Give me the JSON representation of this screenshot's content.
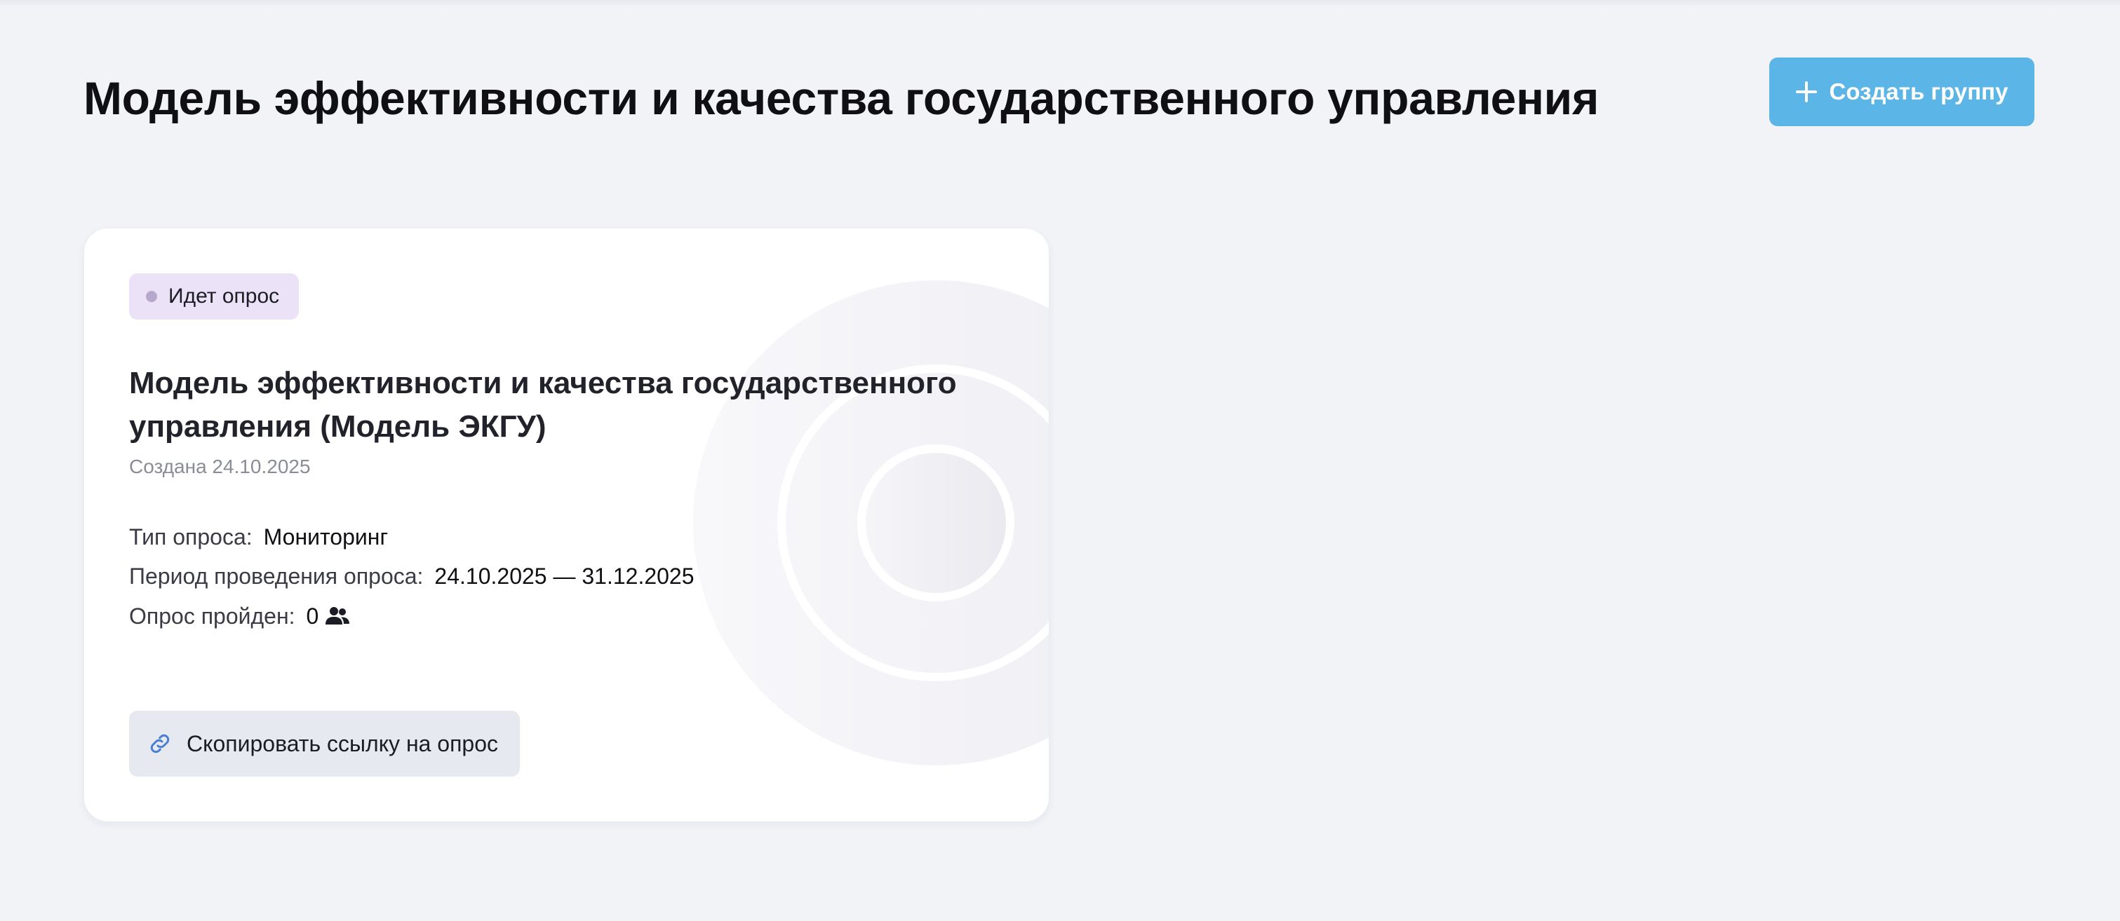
{
  "header": {
    "title": "Модель эффективности и качества государственного управления",
    "create_group_label": "Создать группу"
  },
  "survey_card": {
    "status": "Идет опрос",
    "title": "Модель эффективности и качества государственного управления (Модель ЭКГУ)",
    "created": "Создана 24.10.2025",
    "type_label": "Тип опроса:",
    "type_value": "Мониторинг",
    "period_label": "Период проведения опроса:",
    "period_value": "24.10.2025 — 31.12.2025",
    "passed_label": "Опрос пройден:",
    "passed_value": "0",
    "copy_link_label": "Скопировать ссылку на опрос"
  },
  "icons": {
    "create": "plus-icon",
    "participants": "users-icon",
    "copy": "link-icon"
  },
  "colors": {
    "accent": "#5bb5e6",
    "status_badge_bg": "#ece2f7",
    "status_dot": "#b7a7cd",
    "link_icon": "#4a7fd6",
    "page_bg": "#f1f3f7"
  }
}
